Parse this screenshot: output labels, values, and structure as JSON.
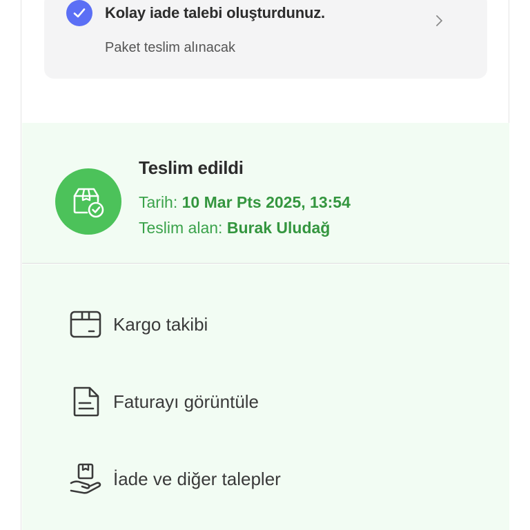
{
  "return_request": {
    "title": "Kolay iade talebi oluşturdunuz.",
    "subtitle": "Paket teslim alınacak",
    "icon": "check-icon",
    "accent_color": "#5b6ff5"
  },
  "delivery": {
    "status": "Teslim edildi",
    "date_label": "Tarih: ",
    "date_value": "10 Mar Pts 2025, 13:54",
    "receiver_label": "Teslim alan: ",
    "receiver_value": "Burak Uludağ",
    "icon": "package-delivered-icon",
    "status_color": "#4cc25a"
  },
  "actions": [
    {
      "label": "Kargo takibi",
      "icon": "package-icon"
    },
    {
      "label": "Faturayı görüntüle",
      "icon": "invoice-icon"
    },
    {
      "label": "İade ve diğer talepler",
      "icon": "return-hand-icon"
    }
  ]
}
